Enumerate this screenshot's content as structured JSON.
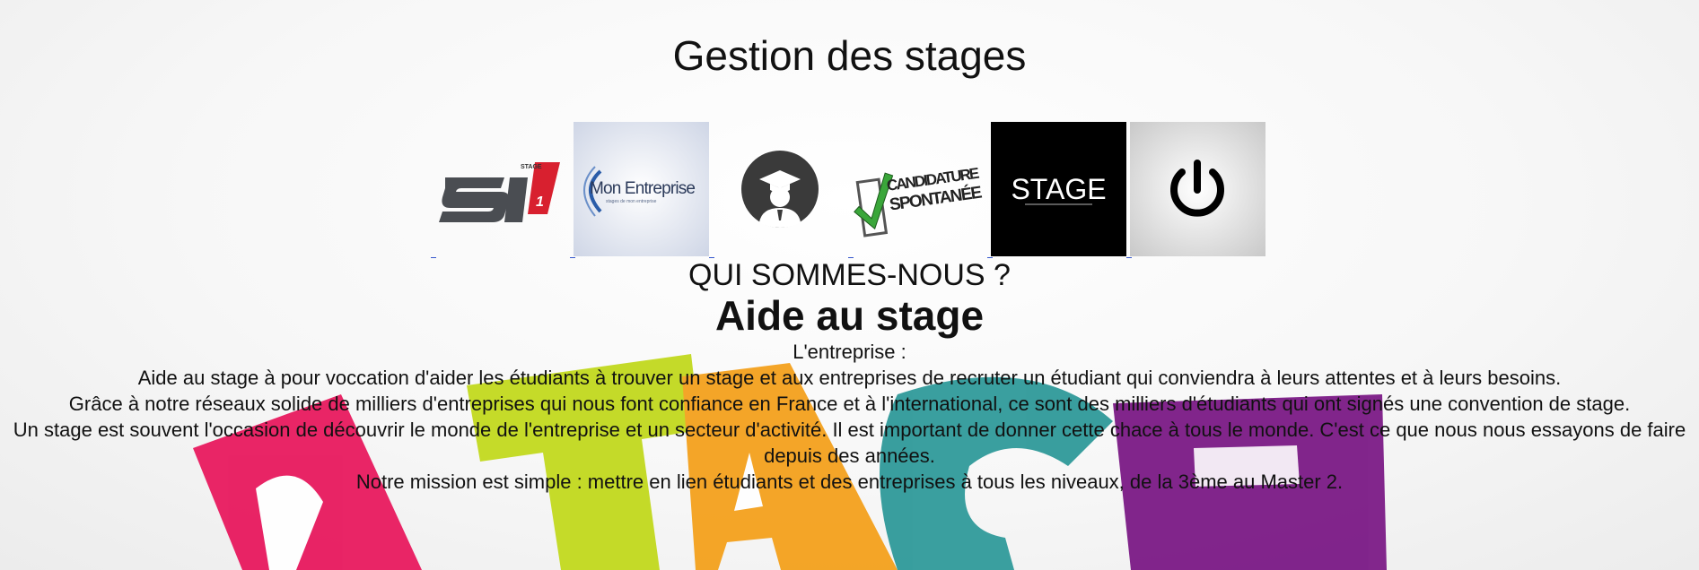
{
  "page": {
    "title": "Gestion des stages"
  },
  "nav": {
    "items": [
      {
        "name": "stage-s1-logo",
        "logo_text_main": "S",
        "logo_text_num": "1",
        "logo_text_small": "STAGE"
      },
      {
        "name": "mon-entreprise",
        "logo_text_main": "Mon Entreprise",
        "logo_text_small": "stages de mon entreprise"
      },
      {
        "name": "student-profile"
      },
      {
        "name": "candidature-spontanee",
        "logo_text_line1": "CANDIDATURE",
        "logo_text_line2": "SPONTANÉE"
      },
      {
        "name": "stage",
        "logo_text_main": "STAGE"
      },
      {
        "name": "logout"
      }
    ]
  },
  "about": {
    "heading": "QUI SOMMES-NOUS ?",
    "brand": "Aide au stage",
    "label": "L'entreprise :",
    "paragraphs": [
      "Aide au stage à pour voccation d'aider les étudiants à trouver un stage et aux entreprises de recruter un étudiant qui conviendra à leurs attentes et à leurs besoins.",
      "Grâce à notre réseaux solide de milliers d'entreprises qui nous font confiance en France et à l'international, ce sont des milliers d'étudiants qui ont signés une convention de stage.",
      "Un stage est souvent l'occasion de découvrir le monde de l'entreprise et un secteur d'activité. Il est important de donner cette chace à tous le monde. C'est ce que nous nous essayons de faire depuis des années.",
      "Notre mission est simple : mettre en lien étudiants et des entreprises à tous les niveaux, de la 3ème au Master 2."
    ]
  },
  "colors": {
    "pink": "#e8195e",
    "lime": "#c2d91e",
    "orange": "#f4a11d",
    "teal": "#2f9a9a",
    "purple": "#7b1a86",
    "s1_red": "#d8202f",
    "check_green": "#3aa63a"
  }
}
